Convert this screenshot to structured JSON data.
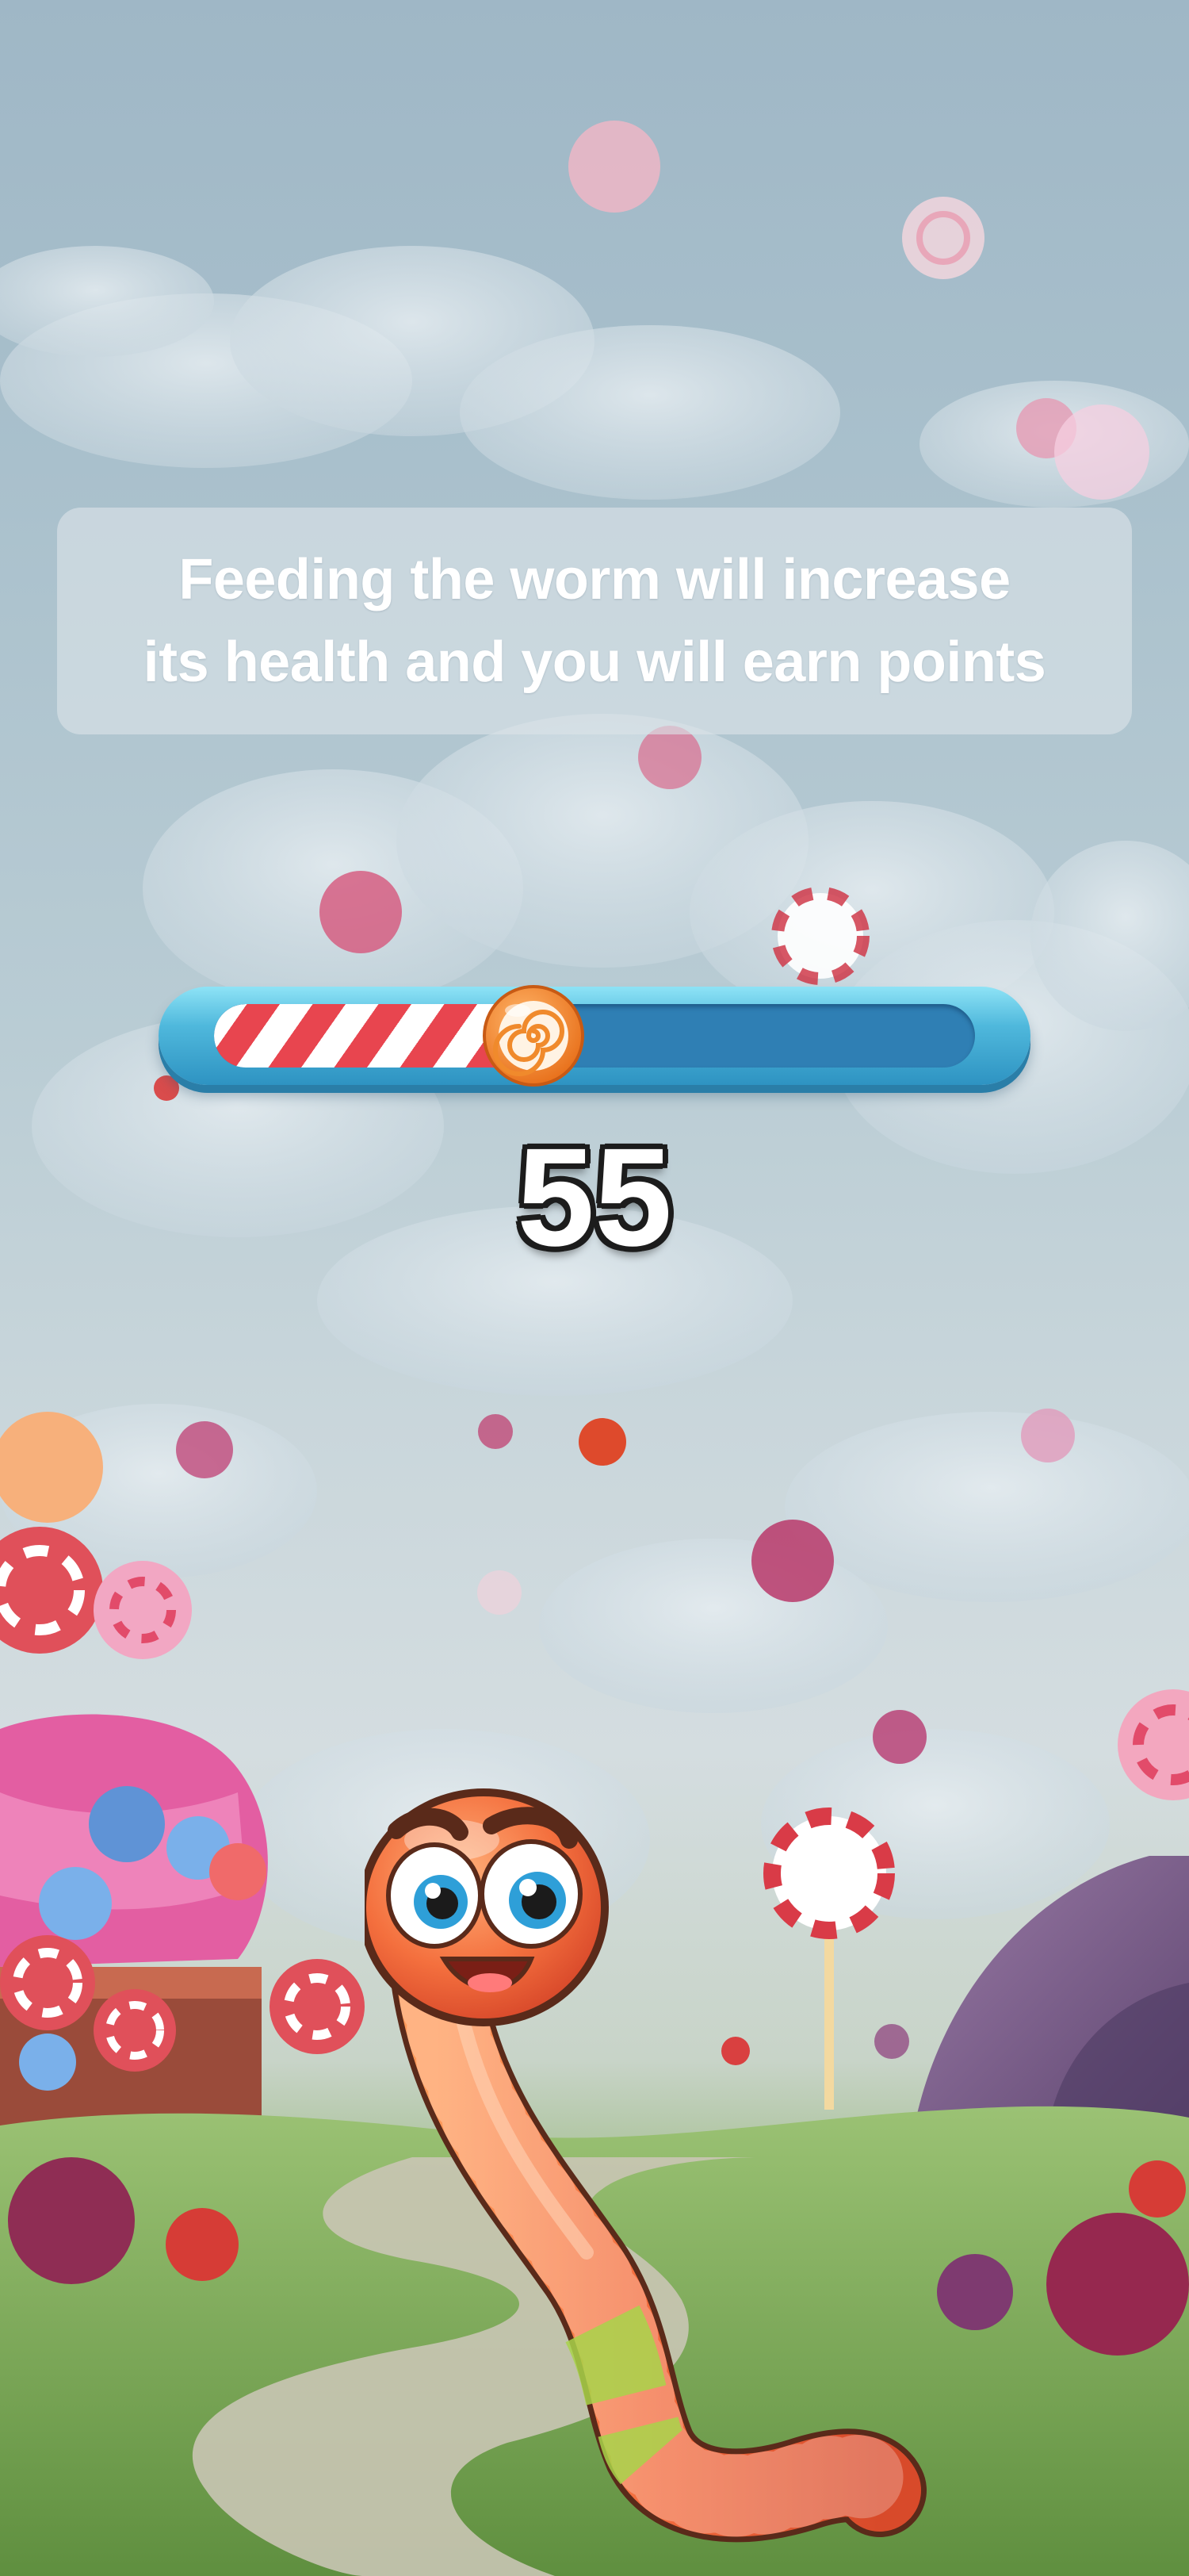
{
  "instruction": {
    "line1": "Feeding the worm will increase",
    "line2": "its health and you will earn points"
  },
  "health": {
    "fraction": 0.42
  },
  "score": {
    "value": "55"
  },
  "colors": {
    "bar_rim": "#4fb8dc",
    "bar_track": "#2f7fb4",
    "stripe_red": "#e8454f",
    "worm_body": "#f26a3c",
    "worm_band_green": "#a8d44a"
  },
  "icons": {
    "knob": "candy-swirl-icon",
    "character": "worm-character"
  }
}
